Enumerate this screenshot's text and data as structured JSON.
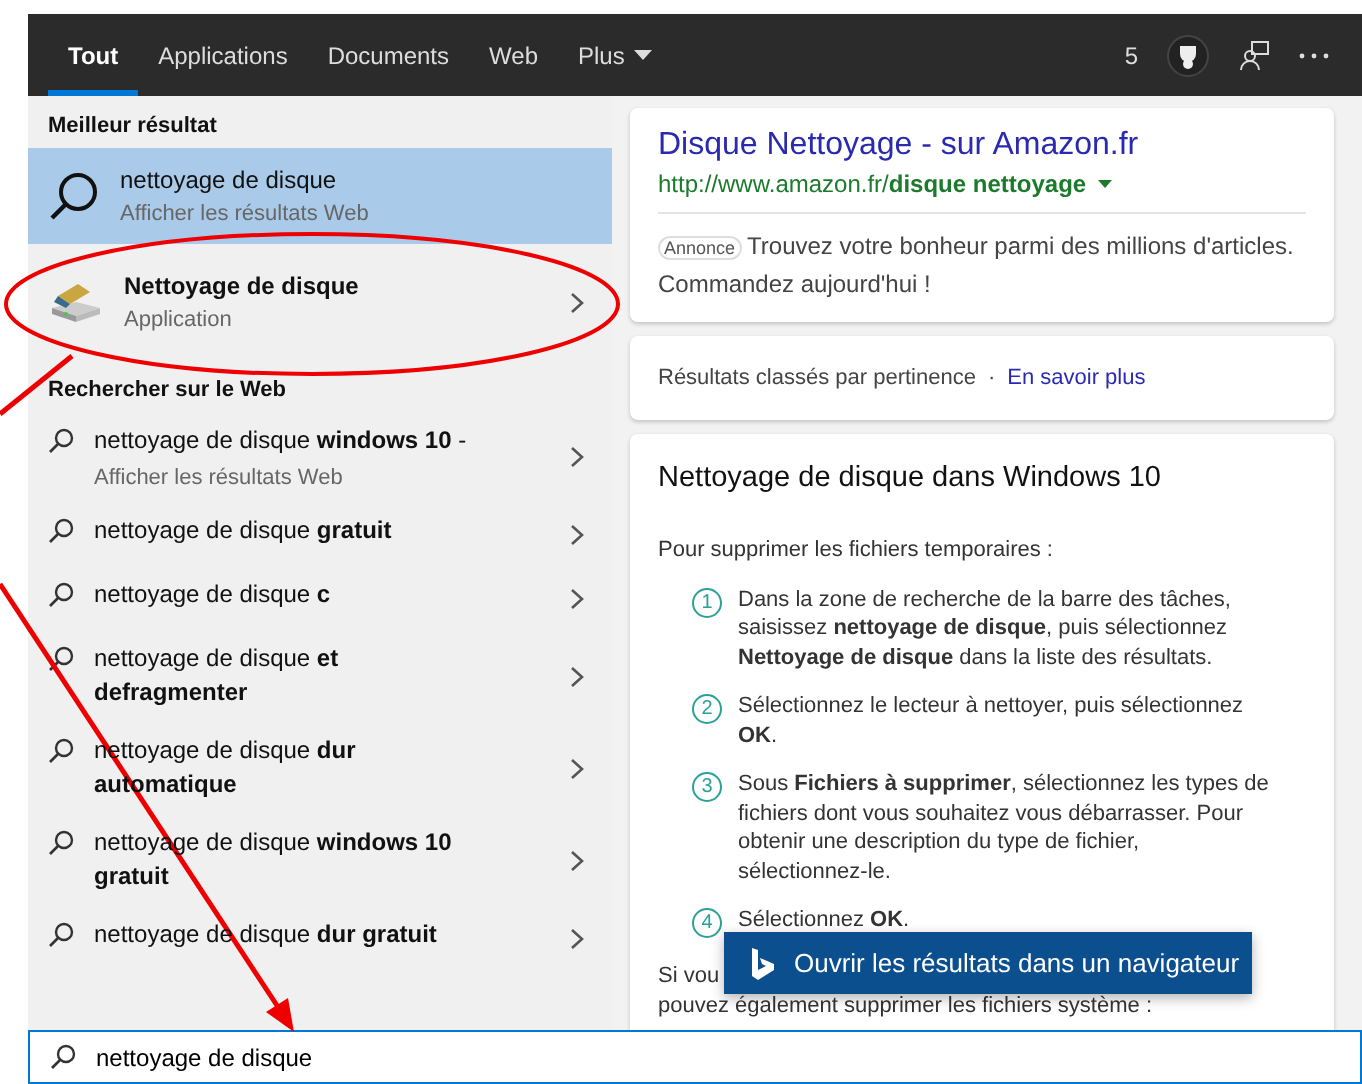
{
  "top_bar": {
    "tabs": [
      {
        "label": "Tout",
        "selected": true
      },
      {
        "label": "Applications",
        "selected": false
      },
      {
        "label": "Documents",
        "selected": false
      },
      {
        "label": "Web",
        "selected": false
      },
      {
        "label": "Plus",
        "selected": false,
        "kind": "menu"
      }
    ],
    "points": "5"
  },
  "best_match": {
    "heading": "Meilleur résultat",
    "items": [
      {
        "kind": "web",
        "title": "nettoyage de disque",
        "subtitle": "Afficher les résultats Web",
        "selected": true
      },
      {
        "kind": "app",
        "title": "Nettoyage de disque",
        "subtitle": "Application",
        "selected": false
      }
    ]
  },
  "web_search": {
    "heading": "Rechercher sur le Web",
    "items": [
      {
        "text": "nettoyage de disque **windows 10** -",
        "subtitle": "Afficher les résultats Web",
        "selected": false
      },
      {
        "text": "nettoyage de disque **gratuit**",
        "selected": false
      },
      {
        "text": "nettoyage de disque **c**",
        "selected": false
      },
      {
        "text": "nettoyage de disque **et defragmenter**",
        "selected": false
      },
      {
        "text": "nettoyage de disque **dur automatique**",
        "selected": false
      },
      {
        "text": "nettoyage de disque **windows 10 gratuit**",
        "selected": false
      },
      {
        "text": "nettoyage de disque **dur gratuit**",
        "selected": false
      }
    ]
  },
  "ad_card": {
    "title": "Disque Nettoyage - sur Amazon.fr",
    "url": "http://www.amazon.fr/**disque nettoyage**",
    "badge": "Annonce",
    "text_lines": [
      "Trouvez votre bonheur parmi des millions d'articles.",
      "Commandez aujourd'hui !"
    ]
  },
  "ranking_card": {
    "text": "Résultats classés par pertinence",
    "separator": "·",
    "link": "En savoir plus"
  },
  "answer_card": {
    "title": "Nettoyage de disque dans Windows 10",
    "intro": "Pour supprimer les fichiers temporaires :",
    "steps": [
      {
        "number": "1",
        "text": "Dans la zone de recherche de la barre des tâches, saisissez **nettoyage de disque**, puis sélectionnez **Nettoyage de disque** dans la liste des résultats."
      },
      {
        "number": "2",
        "text": "Sélectionnez le lecteur à nettoyer, puis sélectionnez **OK**."
      },
      {
        "number": "3",
        "text": "Sous **Fichiers à supprimer**, sélectionnez les types de fichiers dont vous souhaitez vous débarrasser. Pour obtenir une description du type de fichier, sélectionnez-le."
      },
      {
        "number": "4",
        "text": "Sélectionnez **OK**."
      }
    ],
    "outro_lines": [
      "Si vou",
      "pouvez également supprimer les fichiers système :"
    ]
  },
  "open_browser_button": {
    "label": "Ouvrir les résultats dans un navigateur"
  },
  "search_box": {
    "value": "nettoyage de disque"
  }
}
